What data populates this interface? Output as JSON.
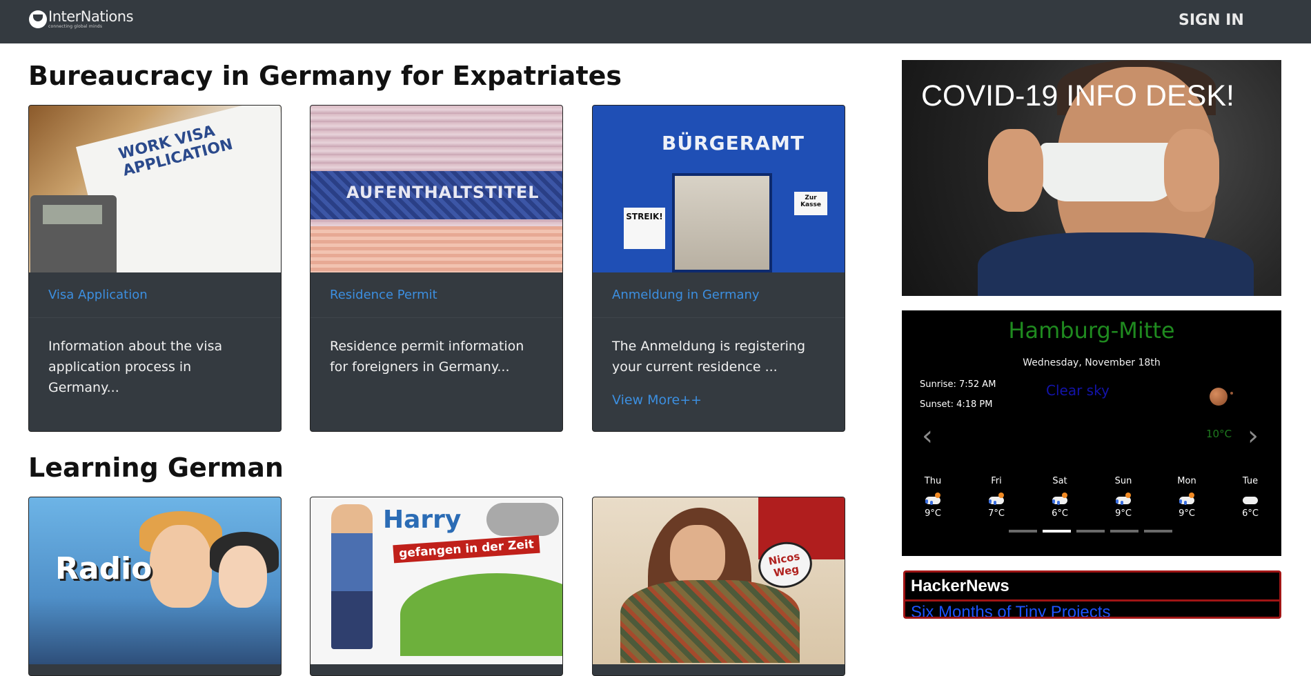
{
  "header": {
    "logo_name": "InterNations",
    "logo_tagline": "connecting global minds",
    "sign_in_label": "SIGN IN"
  },
  "sections": [
    {
      "title": "Bureaucracy in Germany for Expatriates",
      "cards": [
        {
          "link": "Visa Application",
          "description": "Information about the visa application process in Germany...",
          "image_text": "WORK VISA APPLICATION"
        },
        {
          "link": "Residence Permit",
          "description": "Residence permit information for foreigners in Germany...",
          "image_text": "AUFENTHALTSTITEL"
        },
        {
          "link": "Anmeldung in Germany",
          "description": "The Anmeldung is registering your current residence ...",
          "view_more": "View More++",
          "image_text": "BÜRGERAMT",
          "image_sign": "STREIK!",
          "image_sign2": "Zur Kasse"
        }
      ]
    },
    {
      "title": "Learning German",
      "cards": [
        {
          "image_text": "Radio"
        },
        {
          "image_text": "Harry",
          "image_banner": "gefangen in der Zeit"
        },
        {
          "image_text": "Nicos Weg"
        }
      ]
    }
  ],
  "covid": {
    "title": "COVID-19 INFO DESK!"
  },
  "weather": {
    "city": "Hamburg-Mitte",
    "date": "Wednesday, November 18th",
    "sunrise": "Sunrise: 7:52 AM",
    "sunset": "Sunset: 4:18 PM",
    "condition": "Clear sky",
    "temp": "10°C",
    "prev_icon": "chevron-left-icon",
    "next_icon": "chevron-right-icon",
    "forecast": [
      {
        "day": "Thu",
        "temp": "9°C",
        "icon": "cloud-rain-sun-icon"
      },
      {
        "day": "Fri",
        "temp": "7°C",
        "icon": "cloud-rain-sun-icon"
      },
      {
        "day": "Sat",
        "temp": "6°C",
        "icon": "cloud-rain-sun-icon"
      },
      {
        "day": "Sun",
        "temp": "9°C",
        "icon": "cloud-rain-sun-icon"
      },
      {
        "day": "Mon",
        "temp": "9°C",
        "icon": "cloud-rain-sun-icon"
      },
      {
        "day": "Tue",
        "temp": "6°C",
        "icon": "cloud-icon"
      }
    ],
    "active_indicator": 1,
    "colors": {
      "city": "#1f8a1f",
      "condition": "#1313a8"
    }
  },
  "hackernews": {
    "title": "HackerNews",
    "first_link": "Six Months of Tiny Projects"
  }
}
